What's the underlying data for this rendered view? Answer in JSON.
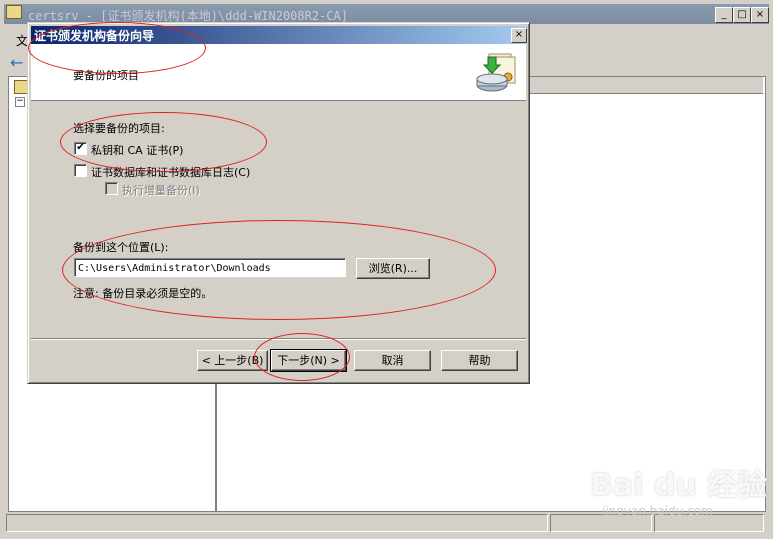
{
  "background_window": {
    "title": "certsrv - [证书颁发机构(本地)\\ddd-WIN2008R2-CA]",
    "menu_label": "文",
    "window_controls": [
      "_",
      "□",
      "×"
    ]
  },
  "wizard": {
    "title": "证书颁发机构备份向导",
    "close_label": "×",
    "header_text": "要备份的项目",
    "items_label": "选择要备份的项目:",
    "options": [
      {
        "label": "私钥和 CA 证书(P)",
        "checked": true,
        "disabled": false
      },
      {
        "label": "证书数据库和证书数据库日志(C)",
        "checked": false,
        "disabled": false
      },
      {
        "label": "执行增量备份(I)",
        "checked": false,
        "disabled": true
      }
    ],
    "location_label": "备份到这个位置(L):",
    "location_value": "C:\\Users\\Administrator\\Downloads",
    "browse_label": "浏览(R)...",
    "note": "注意: 备份目录必须是空的。",
    "buttons": {
      "back": "< 上一步(B)",
      "next": "下一步(N) >",
      "cancel": "取消",
      "help": "帮助"
    }
  },
  "watermark": {
    "main": "Bai du 经验",
    "sub": "jingyan.baidu.com"
  },
  "colors": {
    "title_bar_active": "#0a246a",
    "title_bar_inactive": "#7b8ca3",
    "annotation": "#e02020",
    "face": "#d4d0c8"
  }
}
